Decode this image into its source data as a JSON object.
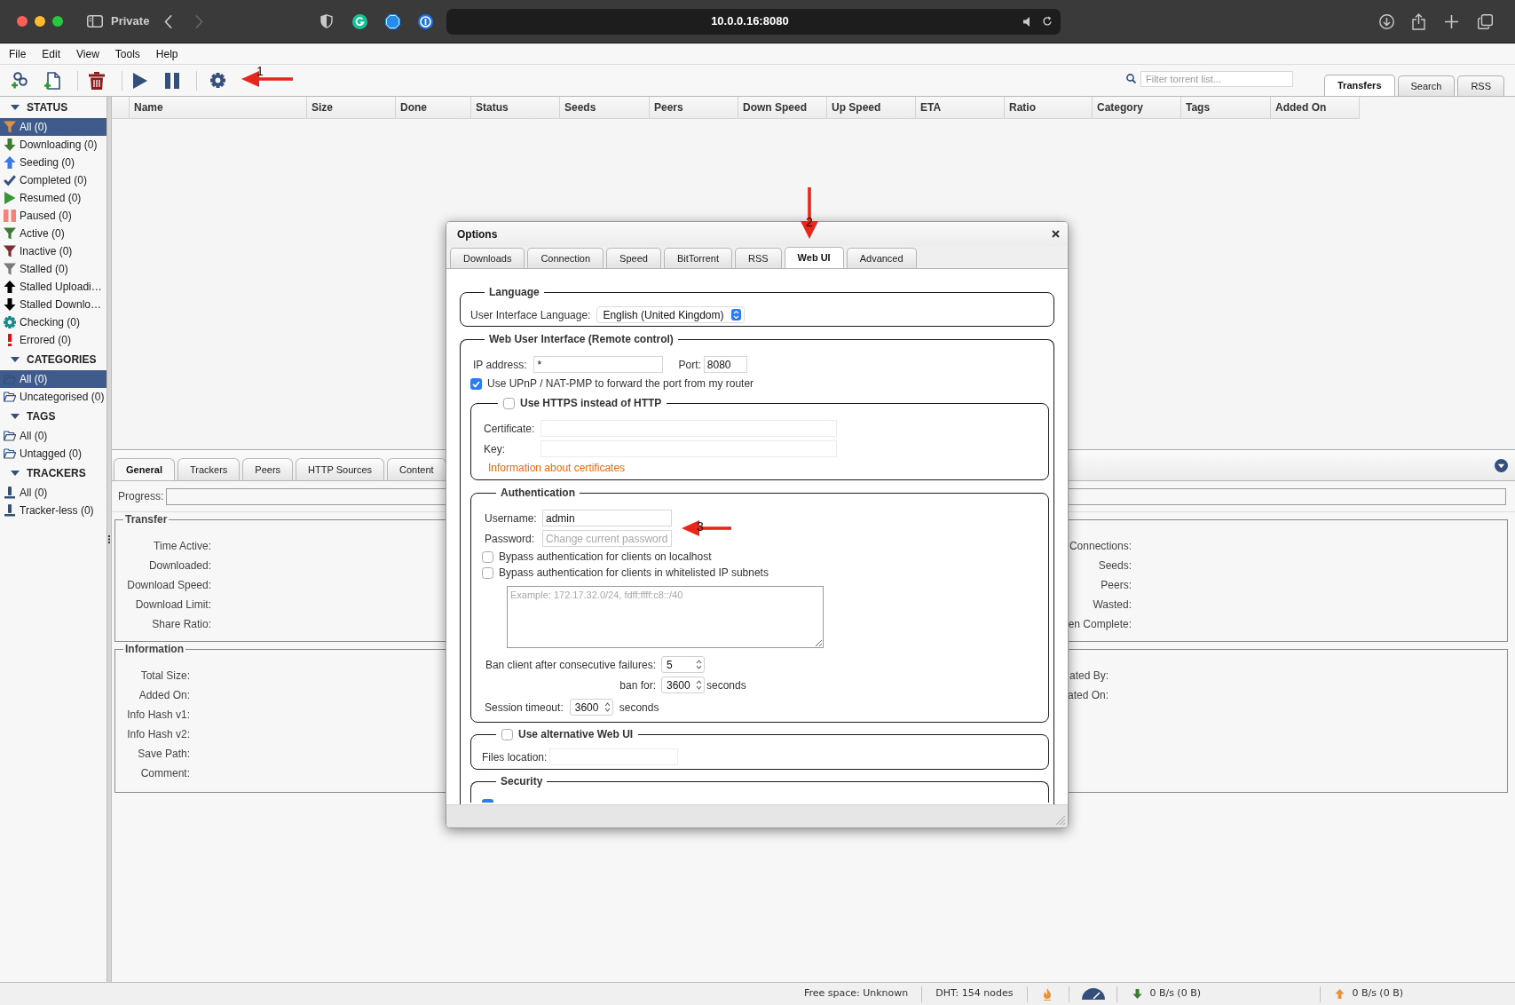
{
  "browser": {
    "private_label": "Private",
    "url": "10.0.0.16:8080",
    "forward_disabled": true
  },
  "menu": [
    "File",
    "Edit",
    "View",
    "Tools",
    "Help"
  ],
  "toolbar": {
    "search": {
      "placeholder": "Filter torrent list..."
    },
    "tabs": [
      {
        "label": "Transfers",
        "selected": true
      },
      {
        "label": "Search",
        "selected": false
      },
      {
        "label": "RSS",
        "selected": false
      }
    ]
  },
  "sidebar": [
    {
      "title": "STATUS",
      "expanded": true,
      "items": [
        {
          "label": "All (0)",
          "kind": "all",
          "selected": true
        },
        {
          "label": "Downloading (0)",
          "kind": "downloading",
          "selected": false
        },
        {
          "label": "Seeding (0)",
          "kind": "seeding",
          "selected": false
        },
        {
          "label": "Completed (0)",
          "kind": "completed",
          "selected": false
        },
        {
          "label": "Resumed (0)",
          "kind": "resumed",
          "selected": false
        },
        {
          "label": "Paused (0)",
          "kind": "paused",
          "selected": false
        },
        {
          "label": "Active (0)",
          "kind": "active",
          "selected": false
        },
        {
          "label": "Inactive (0)",
          "kind": "inactive",
          "selected": false
        },
        {
          "label": "Stalled (0)",
          "kind": "stalled",
          "selected": false
        },
        {
          "label": "Stalled Uploadi…",
          "kind": "stalled_uploading",
          "selected": false
        },
        {
          "label": "Stalled Downlo…",
          "kind": "stalled_downloading",
          "selected": false
        },
        {
          "label": "Checking (0)",
          "kind": "checking",
          "selected": false
        },
        {
          "label": "Errored (0)",
          "kind": "errored",
          "selected": false
        }
      ]
    },
    {
      "title": "CATEGORIES",
      "expanded": true,
      "items": [
        {
          "label": "All (0)",
          "kind": "folder",
          "selected": true
        },
        {
          "label": "Uncategorised (0)",
          "kind": "folder",
          "selected": false
        }
      ]
    },
    {
      "title": "TAGS",
      "expanded": true,
      "items": [
        {
          "label": "All (0)",
          "kind": "folder",
          "selected": false
        },
        {
          "label": "Untagged (0)",
          "kind": "folder",
          "selected": false
        }
      ]
    },
    {
      "title": "TRACKERS",
      "expanded": true,
      "items": [
        {
          "label": "All (0)",
          "kind": "tracker",
          "selected": false
        },
        {
          "label": "Tracker-less (0)",
          "kind": "tracker",
          "selected": false
        }
      ]
    }
  ],
  "torrent_table": {
    "columns": [
      "Name",
      "Size",
      "Done",
      "Status",
      "Seeds",
      "Peers",
      "Down Speed",
      "Up Speed",
      "ETA",
      "Ratio",
      "Category",
      "Tags",
      "Added On"
    ]
  },
  "details": {
    "tabs": [
      {
        "label": "General",
        "selected": true
      },
      {
        "label": "Trackers",
        "selected": false
      },
      {
        "label": "Peers",
        "selected": false
      },
      {
        "label": "HTTP Sources",
        "selected": false
      },
      {
        "label": "Content",
        "selected": false
      }
    ],
    "progress": {
      "label": "Progress:",
      "level": 0
    },
    "groups": [
      {
        "title": "Transfer",
        "left_labels": [
          "Time Active:",
          "Downloaded:",
          "Download Speed:",
          "Download Limit:",
          "Share Ratio:"
        ],
        "right_labels": [
          "Connections:",
          "Seeds:",
          "Peers:",
          "Wasted:",
          "en Complete:"
        ]
      },
      {
        "title": "Information",
        "left_labels": [
          "Total Size:",
          "Added On:",
          "Info Hash v1:",
          "Info Hash v2:",
          "Save Path:",
          "Comment:"
        ],
        "right_labels": [
          "ated By:",
          "ated On:"
        ]
      }
    ]
  },
  "status_bar": {
    "free_space": "Free space: Unknown",
    "dht": "DHT: 154 nodes",
    "download": "0 B/s (0 B)",
    "upload": "0 B/s (0 B)"
  },
  "options_dialog": {
    "title": "Options",
    "tabs": [
      {
        "label": "Downloads",
        "selected": false
      },
      {
        "label": "Connection",
        "selected": false
      },
      {
        "label": "Speed",
        "selected": false
      },
      {
        "label": "BitTorrent",
        "selected": false
      },
      {
        "label": "RSS",
        "selected": false
      },
      {
        "label": "Web UI",
        "selected": true
      },
      {
        "label": "Advanced",
        "selected": false
      }
    ],
    "language": {
      "legend": "Language",
      "label": "User Interface Language:",
      "value": "English (United Kingdom)"
    },
    "web_ui": {
      "legend": "Web User Interface (Remote control)",
      "ip_label": "IP address:",
      "ip_value": "*",
      "port_label": "Port:",
      "port_value": "8080",
      "upnp": {
        "label": "Use UPnP / NAT-PMP to forward the port from my router",
        "checked": true
      },
      "https": {
        "label": "Use HTTPS instead of HTTP",
        "checked": false,
        "certificate_label": "Certificate:",
        "key_label": "Key:",
        "link": "Information about certificates"
      },
      "authentication": {
        "legend": "Authentication",
        "username_label": "Username:",
        "username_value": "admin",
        "password_label": "Password:",
        "password_placeholder": "Change current password",
        "bypass": [
          {
            "label": "Bypass authentication for clients on localhost",
            "checked": false
          },
          {
            "label": "Bypass authentication for clients in whitelisted IP subnets",
            "checked": false
          }
        ],
        "subnets_placeholder": "Example: 172.17.32.0/24, fdff:ffff:c8::/40",
        "ban_label": "Ban client after consecutive failures:",
        "ban_value": "5",
        "ban_for_label": "ban for:",
        "ban_for_value": "3600",
        "ban_for_unit": "seconds",
        "session_label": "Session timeout:",
        "session_value": "3600",
        "session_unit": "seconds"
      },
      "alternative": {
        "label": "Use alternative Web UI",
        "checked": false,
        "files_label": "Files location:"
      },
      "security": {
        "legend": "Security",
        "options": [
          {
            "checked": true
          }
        ]
      }
    }
  },
  "annotations": [
    {
      "label": "1"
    },
    {
      "label": "2"
    },
    {
      "label": "3"
    }
  ]
}
